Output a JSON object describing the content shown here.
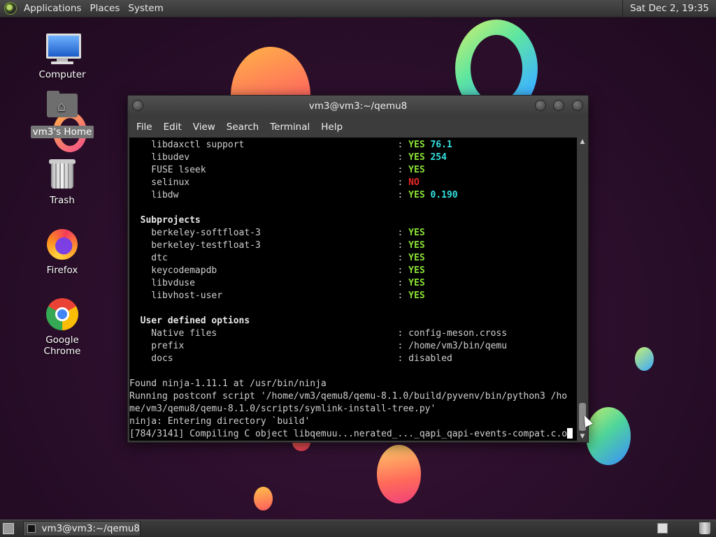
{
  "top_panel": {
    "menus": [
      "Applications",
      "Places",
      "System"
    ],
    "clock": "Sat Dec 2, 19:35"
  },
  "desktop": {
    "icons": [
      {
        "label": "Computer",
        "icon": "computer-icon"
      },
      {
        "label": "vm3's Home",
        "icon": "home-folder-icon"
      },
      {
        "label": "Trash",
        "icon": "trash-icon"
      },
      {
        "label": "Firefox",
        "icon": "firefox-icon"
      },
      {
        "label": "Google Chrome",
        "icon": "chrome-icon"
      }
    ]
  },
  "terminal": {
    "title": "vm3@vm3:~/qemu8",
    "menu": [
      "File",
      "Edit",
      "View",
      "Search",
      "Terminal",
      "Help"
    ],
    "colors": {
      "yes": "#8ae234",
      "no": "#ef2929",
      "version": "#34e2e2"
    },
    "lines": [
      {
        "name": "  libdaxctl support",
        "status": "YES",
        "extra": "76.1"
      },
      {
        "name": "  libudev",
        "status": "YES",
        "extra": "254"
      },
      {
        "name": "  FUSE lseek",
        "status": "YES",
        "extra": ""
      },
      {
        "name": "  selinux",
        "status": "NO",
        "extra": ""
      },
      {
        "name": "  libdw",
        "status": "YES",
        "extra": "0.190"
      },
      {
        "heading": "Subprojects"
      },
      {
        "name": "  berkeley-softfloat-3",
        "status": "YES"
      },
      {
        "name": "  berkeley-testfloat-3",
        "status": "YES"
      },
      {
        "name": "  dtc",
        "status": "YES"
      },
      {
        "name": "  keycodemapdb",
        "status": "YES"
      },
      {
        "name": "  libvduse",
        "status": "YES"
      },
      {
        "name": "  libvhost-user",
        "status": "YES"
      },
      {
        "heading": "User defined options"
      },
      {
        "name": "  Native files",
        "value": "config-meson.cross"
      },
      {
        "name": "  prefix",
        "value": "/home/vm3/bin/qemu"
      },
      {
        "name": "  docs",
        "value": "disabled"
      }
    ],
    "log": [
      "Found ninja-1.11.1 at /usr/bin/ninja",
      "Running postconf script '/home/vm3/qemu8/qemu-8.1.0/build/pyvenv/bin/python3 /ho",
      "me/vm3/qemu8/qemu-8.1.0/scripts/symlink-install-tree.py'",
      "ninja: Entering directory `build'",
      "[784/3141] Compiling C object libqemuu...nerated_..._qapi_qapi-events-compat.c.o"
    ]
  },
  "bottom_panel": {
    "task_label": "vm3@vm3:~/qemu8"
  }
}
